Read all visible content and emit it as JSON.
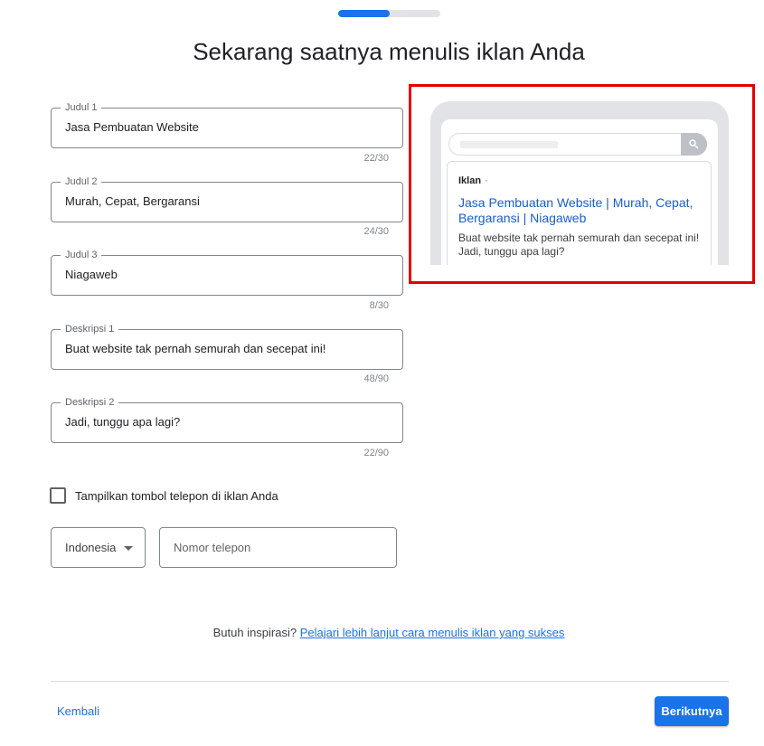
{
  "progress": 0.5,
  "page_title": "Sekarang saatnya menulis iklan Anda",
  "fields": [
    {
      "label": "Judul 1",
      "value": "Jasa Pembuatan Website",
      "counter": "22/30"
    },
    {
      "label": "Judul 2",
      "value": "Murah, Cepat, Bergaransi",
      "counter": "24/30"
    },
    {
      "label": "Judul 3",
      "value": "Niagaweb",
      "counter": "8/30"
    },
    {
      "label": "Deskripsi 1",
      "value": "Buat website tak pernah semurah dan secepat ini!",
      "counter": "48/90"
    },
    {
      "label": "Deskripsi 2",
      "value": "Jadi, tunggu apa lagi?",
      "counter": "22/90"
    }
  ],
  "checkbox": {
    "label": "Tampilkan tombol telepon di iklan Anda",
    "checked": false
  },
  "phone": {
    "country": "Indonesia",
    "placeholder": "Nomor telepon"
  },
  "inspiration": {
    "text": "Butuh inspirasi?",
    "link": "Pelajari lebih lanjut cara menulis iklan yang sukses"
  },
  "nav": {
    "back": "Kembali",
    "next": "Berikutnya"
  },
  "preview": {
    "badge": "Iklan",
    "badge_sep": "·",
    "headline": "Jasa Pembuatan Website | Murah, Cepat, Bergaransi | Niagaweb",
    "description": "Buat website tak pernah semurah dan secepat ini! Jadi, tunggu apa lagi?"
  },
  "colors": {
    "accent": "#1a73e8",
    "highlight": "#e50000",
    "link_blue": "#1a5dc9"
  },
  "icons": {
    "search": "search-icon",
    "dropdown": "chevron-down-icon"
  }
}
